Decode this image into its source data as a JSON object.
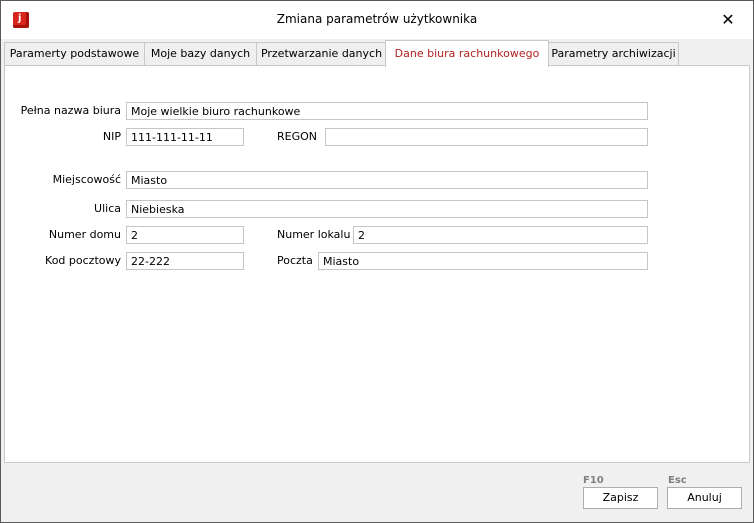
{
  "window": {
    "title": "Zmiana parametrów użytkownika",
    "app_icon_letter": "j",
    "close_glyph": "✕"
  },
  "tabs": [
    {
      "label": "Paramerty podstawowe"
    },
    {
      "label": "Moje bazy danych"
    },
    {
      "label": "Przetwarzanie danych"
    },
    {
      "label": "Dane biura rachunkowego",
      "active": true
    },
    {
      "label": "Parametry archiwizacji"
    }
  ],
  "form": {
    "pelna_nazwa": {
      "label": "Pełna nazwa biura",
      "value": "Moje wielkie biuro rachunkowe"
    },
    "nip": {
      "label": "NIP",
      "value": "111-111-11-11"
    },
    "regon": {
      "label": "REGON",
      "value": ""
    },
    "miejscowosc": {
      "label": "Miejscowość",
      "value": "Miasto"
    },
    "ulica": {
      "label": "Ulica",
      "value": "Niebieska"
    },
    "numer_domu": {
      "label": "Numer domu",
      "value": "2"
    },
    "numer_lokalu": {
      "label": "Numer lokalu",
      "value": "2"
    },
    "kod_pocztowy": {
      "label": "Kod pocztowy",
      "value": "22-222"
    },
    "poczta": {
      "label": "Poczta",
      "value": "Miasto"
    }
  },
  "footer": {
    "save": {
      "shortcut": "F10",
      "label": "Zapisz"
    },
    "cancel": {
      "shortcut": "Esc",
      "label": "Anuluj"
    }
  },
  "colors": {
    "active_tab_text": "#b22222",
    "app_icon": "#d9261c"
  }
}
